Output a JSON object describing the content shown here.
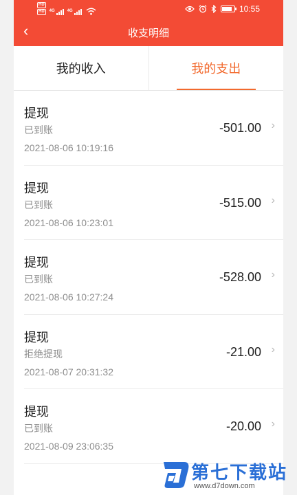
{
  "status_bar": {
    "hd1": "HD",
    "hd2": "HD",
    "net1": "4G",
    "net2": "4G",
    "time": "10:55",
    "battery_level": 0.8,
    "icons": [
      "eye-icon",
      "alarm-icon",
      "bluetooth-icon",
      "battery-icon"
    ]
  },
  "nav": {
    "back_icon": "‹",
    "title": "收支明细"
  },
  "tabs": [
    {
      "label": "我的收入",
      "active": false
    },
    {
      "label": "我的支出",
      "active": true
    }
  ],
  "records": [
    {
      "title": "提现",
      "status": "已到账",
      "time": "2021-08-06 10:19:16",
      "amount": "-501.00"
    },
    {
      "title": "提现",
      "status": "已到账",
      "time": "2021-08-06 10:23:01",
      "amount": "-515.00"
    },
    {
      "title": "提现",
      "status": "已到账",
      "time": "2021-08-06 10:27:24",
      "amount": "-528.00"
    },
    {
      "title": "提现",
      "status": "拒绝提现",
      "time": "2021-08-07 20:31:32",
      "amount": "-21.00"
    },
    {
      "title": "提现",
      "status": "已到账",
      "time": "2021-08-09 23:06:35",
      "amount": "-20.00"
    }
  ],
  "watermark": {
    "name": "第七下载站",
    "url": "www.d7down.com"
  },
  "colors": {
    "header": "#f34b35",
    "active_tab": "#f26a2e",
    "secondary_text": "#8d8d8d",
    "watermark": "#2a6fd6"
  }
}
